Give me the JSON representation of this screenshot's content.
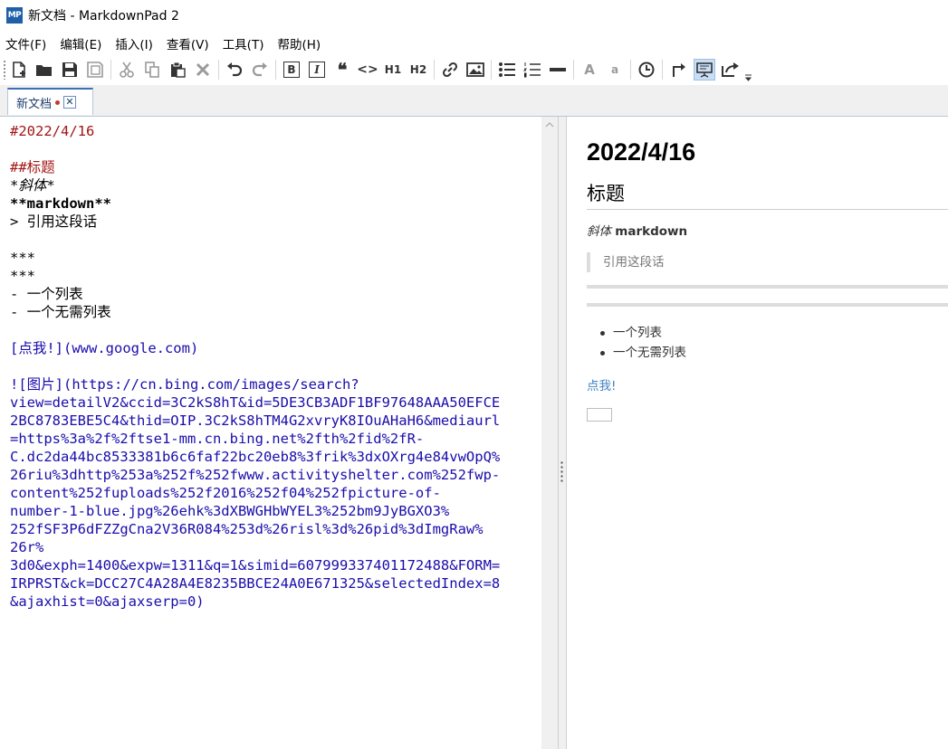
{
  "window": {
    "app_icon_text": "MP",
    "title": "新文档 - MarkdownPad 2"
  },
  "menu": [
    "文件(F)",
    "编辑(E)",
    "插入(I)",
    "查看(V)",
    "工具(T)",
    "帮助(H)"
  ],
  "toolbar": {
    "quote_label": "❝",
    "code_label": "<>",
    "h1_label": "H1",
    "h2_label": "H2",
    "font_big_label": "A",
    "font_small_label": "a"
  },
  "tab": {
    "label": "新文档",
    "close_label": "✕",
    "modified": true
  },
  "editor": {
    "lines": [
      "#2022/4/16",
      "",
      "##标题",
      "*斜体*",
      "**markdown**",
      "> 引用这段话",
      "",
      "***",
      "***",
      "- 一个列表",
      "- 一个无需列表",
      "",
      "[点我!](www.google.com)",
      "",
      "![图片](https://cn.bing.com/images/search?",
      "view=detailV2&ccid=3C2kS8hT&id=5DE3CB3ADF1BF97648AAA50EFCE",
      "2BC8783EBE5C4&thid=OIP.3C2kS8hTM4G2xvryK8IOuAHaH6&mediaurl",
      "=https%3a%2f%2ftse1-mm.cn.bing.net%2fth%2fid%2fR-",
      "C.dc2da44bc8533381b6c6faf22bc20eb8%3frik%3dxOXrg4e84vwOpQ%",
      "26riu%3dhttp%253a%252f%252fwww.activityshelter.com%252fwp-",
      "content%252fuploads%252f2016%252f04%252fpicture-of-",
      "number-1-blue.jpg%26ehk%3dXBWGHbWYEL3%252bm9JyBGXO3%",
      "252fSF3P6dFZZgCna2V36R084%253d%26risl%3d%26pid%3dImgRaw%",
      "26r%",
      "3d0&exph=1400&expw=1311&q=1&simid=607999337401172488&FORM=",
      "IRPRST&ck=DCC27C4A28A4E8235BBCE24A0E671325&selectedIndex=8",
      "&ajaxhist=0&ajaxserp=0)"
    ]
  },
  "preview": {
    "h1": "2022/4/16",
    "h2": "标题",
    "para_em": "斜体",
    "para_strong": "markdown",
    "quote": "引用这段话",
    "list": [
      "一个列表",
      "一个无需列表"
    ],
    "link": "点我!"
  }
}
